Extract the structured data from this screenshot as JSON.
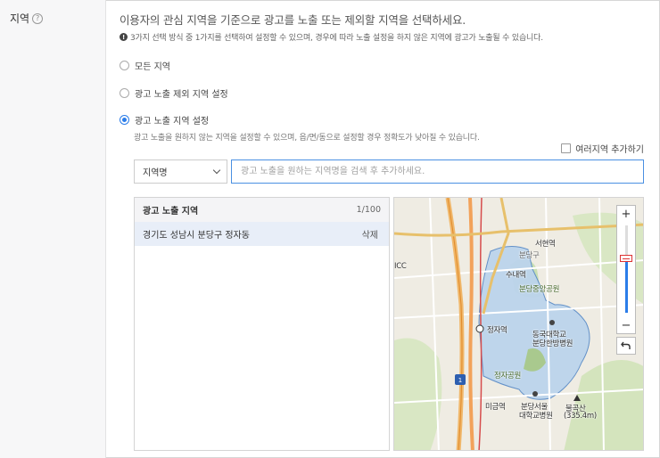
{
  "section": {
    "label": "지역",
    "help_icon": "?",
    "description": "이용자의 관심 지역을 기준으로 광고를 노출 또는 제외할 지역을 선택하세요.",
    "note": "3가지 선택 방식 중 1가지를 선택하여 설정할 수 있으며, 경우에 따라 노출 설정을 하지 않은 지역에 광고가 노출될 수 있습니다."
  },
  "options": [
    {
      "label": "모든 지역",
      "selected": false
    },
    {
      "label": "광고 노출 제외 지역 설정",
      "selected": false
    },
    {
      "label": "광고 노출 지역 설정",
      "selected": true
    }
  ],
  "option_desc": "광고 노출을 원하지 않는 지역을 설정할 수 있으며, 읍/면/동으로 설정할 경우 정확도가 낮아질 수 있습니다.",
  "multi_add_label": "여러지역 추가하기",
  "select": {
    "value": "지역명"
  },
  "search": {
    "placeholder": "광고 노출을 원하는 지역명을 검색 후 추가하세요."
  },
  "list": {
    "title": "광고 노출 지역",
    "count": "1/100",
    "items": [
      {
        "name": "경기도 성남시 분당구 정자동",
        "action": "삭제"
      }
    ]
  },
  "map": {
    "labels": {
      "seohyeon": "서현역",
      "bundang_gu": "분당구",
      "sunae": "수내역",
      "park": "분당중앙공원",
      "jeongja": "정자역",
      "dongguk": "동국대학교",
      "dongguk2": "분당한방병원",
      "jeongja_park": "정자공원",
      "migeum": "미금역",
      "snuh": "분당서울",
      "snuh2": "대학교병원",
      "bulgok": "불곡산",
      "bulgok_h": "(335.4m)",
      "icc": "ICC",
      "route": "1"
    },
    "zoom_in": "+",
    "zoom_out": "−"
  }
}
